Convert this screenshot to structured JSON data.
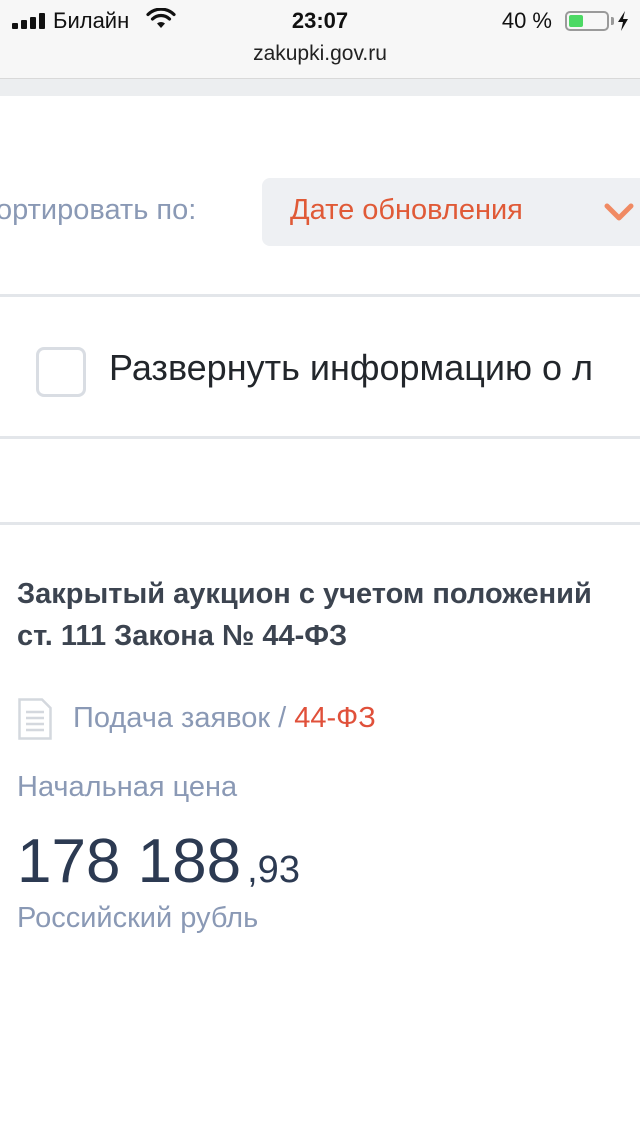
{
  "status_bar": {
    "carrier": "Билайн",
    "time": "23:07",
    "battery_percent_text": "40 %",
    "battery_level": 0.4,
    "icons": [
      "signal-icon",
      "wifi-icon",
      "battery-icon",
      "charging-bolt-icon"
    ]
  },
  "browser": {
    "url": "zakupki.gov.ru"
  },
  "sort": {
    "label": "ортировать по:",
    "selected": "Дате обновления",
    "icon": "chevron-down-icon",
    "accent_color": "#e05a37"
  },
  "expand_checkbox": {
    "label": "Развернуть информацию о л",
    "checked": false
  },
  "card": {
    "title": "Закрытый аукцион с учетом положений ст. 111 Закона № 44-ФЗ",
    "stage": "Подача заявок",
    "separator": " / ",
    "law": "44-ФЗ",
    "doc_icon": "document-icon",
    "price_label": "Начальная цена",
    "price_integer": "178 188",
    "price_fraction": ",93",
    "currency": "Российский рубль"
  },
  "colors": {
    "muted_text": "#8a99b5",
    "price_text": "#2c3a52",
    "law_red": "#e0503a"
  }
}
